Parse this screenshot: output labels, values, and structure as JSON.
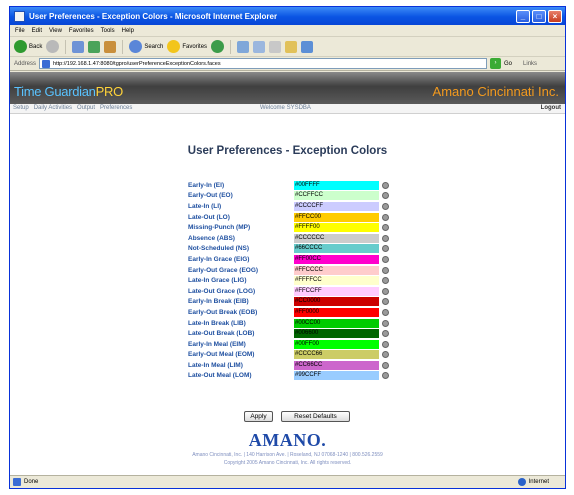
{
  "window": {
    "title": "User Preferences - Exception Colors - Microsoft Internet Explorer"
  },
  "menu": [
    "File",
    "Edit",
    "View",
    "Favorites",
    "Tools",
    "Help"
  ],
  "toolbar": {
    "back_label": "Back",
    "search_label": "Search",
    "favorites_label": "Favorites"
  },
  "address": {
    "label": "Address",
    "url": "http://192.168.1.47:8080/tgpro/userPreferenceExceptionColors.faces",
    "go_label": "Go",
    "links_label": "Links"
  },
  "header": {
    "logo_main": "Time Guardian",
    "logo_pro": "PRO",
    "company": "Amano Cincinnati Inc."
  },
  "nav": {
    "items": [
      "Setup",
      "Daily Activities",
      "Output",
      "Preferences"
    ],
    "welcome": "Welcome SYSDBA",
    "logout": "Logout"
  },
  "page_title": "User Preferences - Exception Colors",
  "colors": [
    {
      "label": "Early-In (EI)",
      "value": "#00FFFF",
      "color": "#00FFFF"
    },
    {
      "label": "Early-Out (EO)",
      "value": "#CCFFCC",
      "color": "#CCFFCC"
    },
    {
      "label": "Late-In (LI)",
      "value": "#CCCCFF",
      "color": "#CCCCFF"
    },
    {
      "label": "Late-Out (LO)",
      "value": "#FFCC00",
      "color": "#FFCC00"
    },
    {
      "label": "Missing-Punch (MP)",
      "value": "#FFFF00",
      "color": "#FFFF00"
    },
    {
      "label": "Absence (ABS)",
      "value": "#CCCCCC",
      "color": "#CCCCCC"
    },
    {
      "label": "Not-Scheduled (NS)",
      "value": "#66CCCC",
      "color": "#66CCCC"
    },
    {
      "label": "Early-In Grace (EIG)",
      "value": "#FF00CC",
      "color": "#FF00CC"
    },
    {
      "label": "Early-Out Grace (EOG)",
      "value": "#FFCCCC",
      "color": "#FFCCCC"
    },
    {
      "label": "Late-In Grace (LIG)",
      "value": "#FFFFCC",
      "color": "#FFFFCC"
    },
    {
      "label": "Late-Out Grace (LOG)",
      "value": "#FFCCFF",
      "color": "#FFCCFF"
    },
    {
      "label": "Early-In Break (EIB)",
      "value": "#CC0000",
      "color": "#CC0000"
    },
    {
      "label": "Early-Out Break (EOB)",
      "value": "#FF0000",
      "color": "#FF0000"
    },
    {
      "label": "Late-In Break (LIB)",
      "value": "#00CC00",
      "color": "#00CC00"
    },
    {
      "label": "Late-Out Break (LOB)",
      "value": "#006600",
      "color": "#006600"
    },
    {
      "label": "Early-In Meal (EIM)",
      "value": "#00FF00",
      "color": "#00FF00"
    },
    {
      "label": "Early-Out Meal (EOM)",
      "value": "#CCCC66",
      "color": "#CCCC66"
    },
    {
      "label": "Late-In Meal (LIM)",
      "value": "#CC66CC",
      "color": "#CC66CC"
    },
    {
      "label": "Late-Out Meal (LOM)",
      "value": "#99CCFF",
      "color": "#99CCFF"
    }
  ],
  "buttons": {
    "apply": "Apply",
    "reset": "Reset Defaults"
  },
  "footer": {
    "logo": "AMANO.",
    "line1": "Amano Cincinnati, Inc. | 140 Harrison Ave. | Roseland, NJ 07068-1240 | 800.526.2559",
    "line2": "Copyright 2005 Amano Cincinnati, Inc. All rights reserved."
  },
  "status": {
    "left": "Done",
    "zone": "Internet"
  }
}
